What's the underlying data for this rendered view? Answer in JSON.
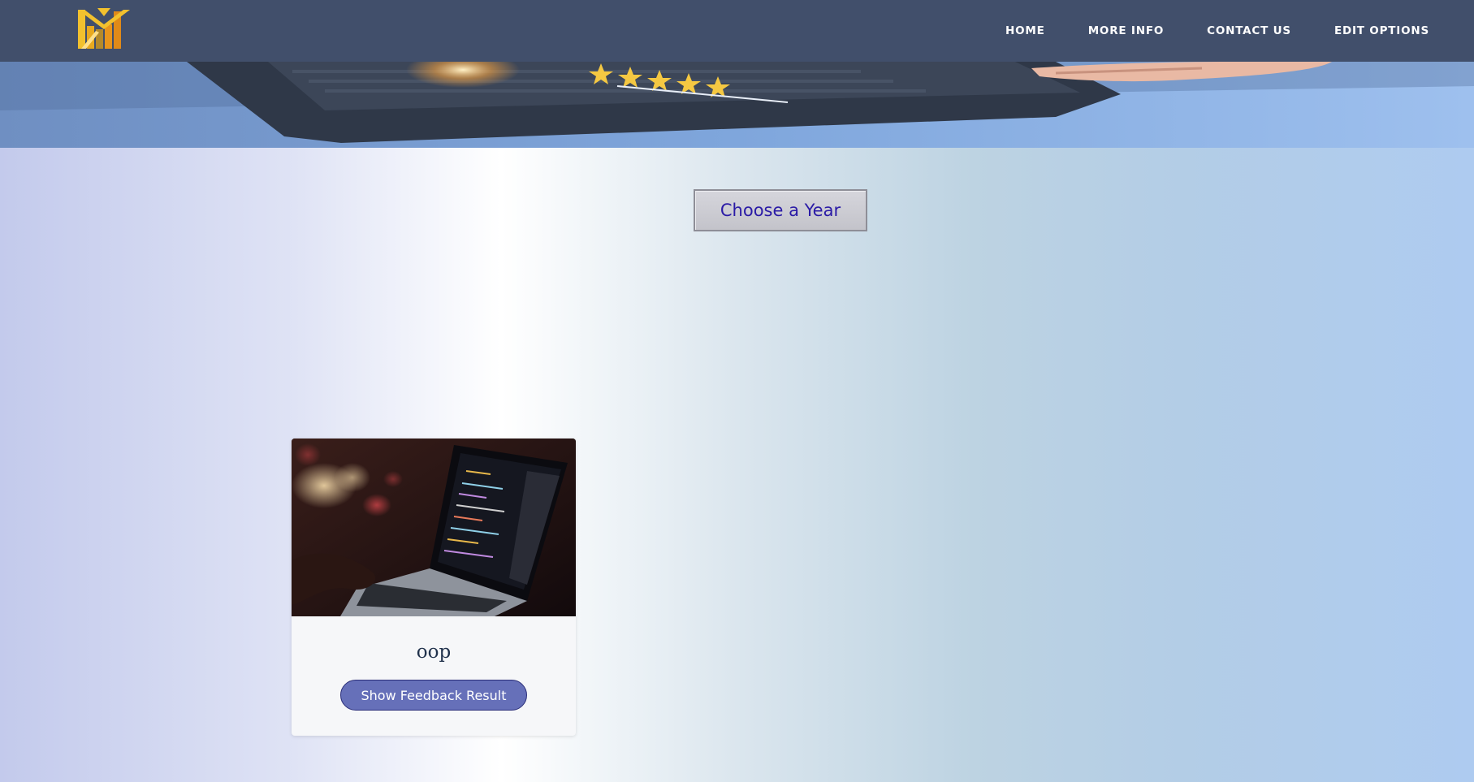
{
  "nav": {
    "items": [
      {
        "label": "HOME"
      },
      {
        "label": "MORE INFO"
      },
      {
        "label": "CONTACT US"
      },
      {
        "label": "EDIT OPTIONS"
      }
    ]
  },
  "logo": {
    "icon": "m-logo-icon",
    "colors": [
      "#f2c12e",
      "#e8951c",
      "#d9781a"
    ]
  },
  "hero": {
    "image": "laptop-five-star-rating-banner"
  },
  "year_selector": {
    "label": "Choose a Year"
  },
  "cards": [
    {
      "image": "laptop-code-photo",
      "title": "oop",
      "button_label": "Show Feedback Result"
    }
  ],
  "colors": {
    "navbar": "#414f6b",
    "year_text": "#2a1aa6",
    "button_bg": "#6670b9"
  }
}
